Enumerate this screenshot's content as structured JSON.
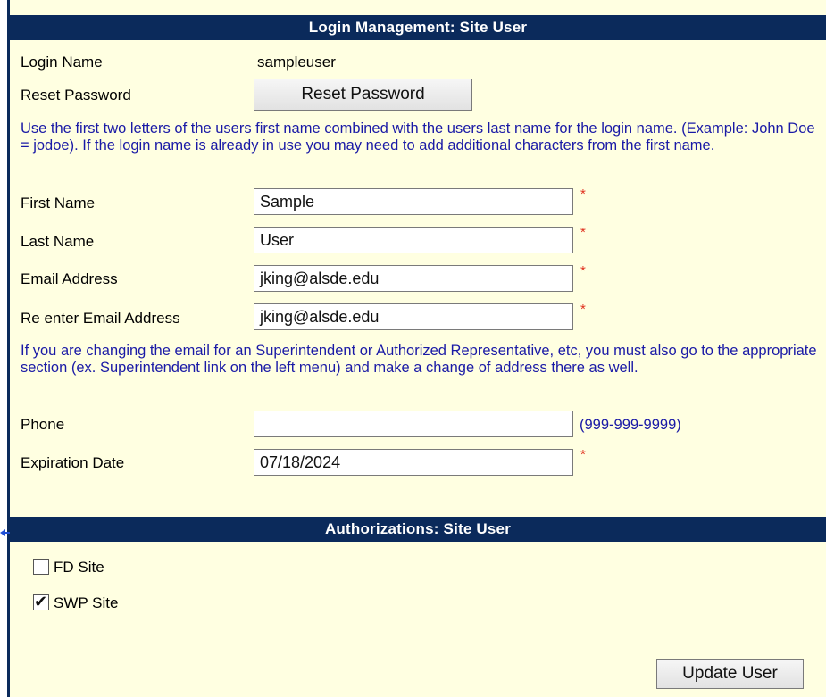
{
  "login_section": {
    "header": "Login Management: Site User",
    "login_name_label": "Login Name",
    "login_name_value": "sampleuser",
    "reset_password_label": "Reset Password",
    "reset_password_button": "Reset Password",
    "instructions": "Use the first two letters of the users first name combined with the users last name for the login name. (Example: John Doe = jodoe). If the login name is already in use you may need to add additional characters from the first name.",
    "first_name_label": "First Name",
    "first_name_value": "Sample",
    "last_name_label": "Last Name",
    "last_name_value": "User",
    "email_label": "Email Address",
    "email_value": "jking@alsde.edu",
    "reenter_email_label": "Re enter Email Address",
    "reenter_email_value": "jking@alsde.edu",
    "email_note": "If you are changing the email for an Superintendent or Authorized Representative, etc, you must also go to the appropriate section (ex. Superintendent link on the left menu) and make a change of address there as well.",
    "phone_label": "Phone",
    "phone_value": "",
    "phone_hint": "(999-999-9999)",
    "expiration_label": "Expiration Date",
    "expiration_value": "07/18/2024",
    "required_marker": "*"
  },
  "auth_section": {
    "header": "Authorizations: Site User",
    "checkboxes": [
      {
        "label": "FD Site",
        "checked": false
      },
      {
        "label": "SWP Site",
        "checked": true
      }
    ],
    "check_glyph": "✔",
    "update_button": "Update User"
  },
  "colors": {
    "header_bg": "#0b2a5b",
    "panel_bg": "#ffffe1",
    "info_text": "#1a1aa6",
    "required": "#e0301e",
    "arrow": "#1f4fd6"
  }
}
